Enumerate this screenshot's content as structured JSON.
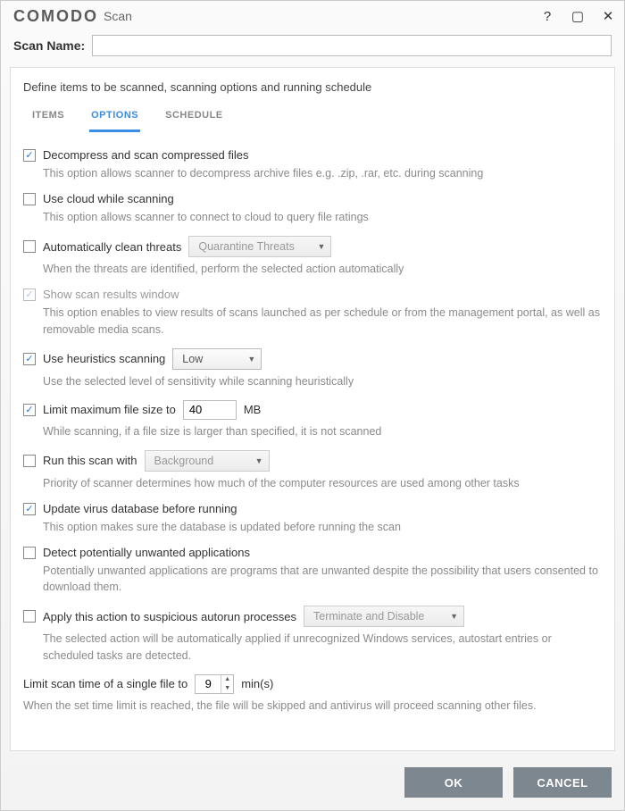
{
  "titlebar": {
    "brand": "COMODO",
    "sub": "Scan"
  },
  "scanName": {
    "label": "Scan Name:",
    "value": ""
  },
  "panel": {
    "desc": "Define items to be scanned, scanning options and running schedule",
    "tabs": {
      "items": "ITEMS",
      "options": "OPTIONS",
      "schedule": "SCHEDULE"
    }
  },
  "opts": {
    "decompress": {
      "label": "Decompress and scan compressed files",
      "desc": "This option allows scanner to decompress archive files e.g. .zip, .rar, etc. during scanning",
      "checked": true
    },
    "cloud": {
      "label": "Use cloud while scanning",
      "desc": "This option allows scanner to connect to cloud to query file ratings",
      "checked": false
    },
    "autoclean": {
      "label": "Automatically clean threats",
      "desc": "When the threats are identified, perform the selected action automatically",
      "checked": false,
      "select": "Quarantine Threats"
    },
    "results": {
      "label": "Show scan results window",
      "desc": "This option enables to view results of scans launched as per schedule or from the management portal, as well as removable media scans.",
      "checked": true,
      "disabled": true
    },
    "heur": {
      "label": "Use heuristics scanning",
      "desc": "Use the selected level of sensitivity while scanning heuristically",
      "checked": true,
      "select": "Low"
    },
    "maxfile": {
      "label": "Limit maximum file size to",
      "value": "40",
      "unit": "MB",
      "desc": "While scanning, if a file size is larger than specified, it is not scanned",
      "checked": true
    },
    "priority": {
      "label": "Run this scan with",
      "select": "Background",
      "desc": "Priority of scanner determines how much of the computer resources are used among other tasks",
      "checked": false
    },
    "update": {
      "label": "Update virus database before running",
      "desc": "This option makes sure the database is updated before running the scan",
      "checked": true
    },
    "pua": {
      "label": "Detect potentially unwanted applications",
      "desc": "Potentially unwanted applications are programs that are unwanted despite the possibility that users consented to download them.",
      "checked": false
    },
    "autorun": {
      "label": "Apply this action to suspicious autorun processes",
      "select": "Terminate and Disable",
      "desc": "The selected action will be automatically applied if unrecognized Windows services, autostart entries or scheduled tasks are detected.",
      "checked": false
    },
    "timelimit": {
      "label": "Limit scan time of a single file to",
      "value": "9",
      "unit": "min(s)",
      "desc": "When the set time limit is reached, the file will be skipped and antivirus will proceed scanning other files."
    }
  },
  "footer": {
    "ok": "OK",
    "cancel": "CANCEL"
  }
}
